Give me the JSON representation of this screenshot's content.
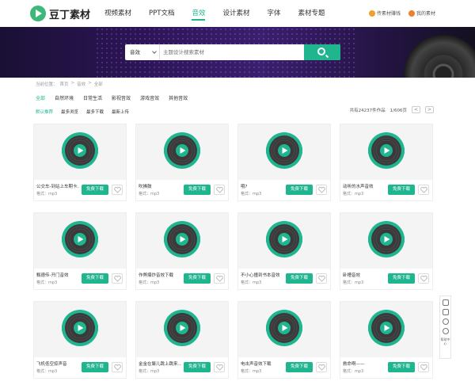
{
  "logo": {
    "text": "豆丁素材"
  },
  "nav": [
    {
      "label": "视频素材",
      "active": false
    },
    {
      "label": "PPT文档",
      "active": false
    },
    {
      "label": "音效",
      "active": true
    },
    {
      "label": "设计素材",
      "active": false
    },
    {
      "label": "字体",
      "active": false
    },
    {
      "label": "素材专题",
      "active": false
    }
  ],
  "top_right": {
    "upload_label": "传素材赚钱",
    "my_label": "我的素材"
  },
  "search": {
    "type_label": "音效",
    "placeholder": "主题设计搜索素材"
  },
  "breadcrumb": [
    "当前位置：",
    "首页",
    ">",
    "音效",
    ">",
    "全部"
  ],
  "categories": [
    {
      "label": "全部",
      "active": true
    },
    {
      "label": "自然环境",
      "active": false
    },
    {
      "label": "日常生活",
      "active": false
    },
    {
      "label": "影视音效",
      "active": false
    },
    {
      "label": "游戏音效",
      "active": false
    },
    {
      "label": "其他音效",
      "active": false
    }
  ],
  "sorts": [
    {
      "label": "默认推荐",
      "active": true
    },
    {
      "label": "最多浏览",
      "active": false
    },
    {
      "label": "最多下载",
      "active": false
    },
    {
      "label": "最新上传",
      "active": false
    }
  ],
  "summary": {
    "total": "共有24237件作品",
    "page": "1/606页",
    "prev": "<",
    "next": ">"
  },
  "card_common": {
    "format": "格式：mp3",
    "download_label": "免费下载"
  },
  "cards": [
    {
      "title": "公交车-到站上车期卡..."
    },
    {
      "title": "吹拂鼓"
    },
    {
      "title": "哦?"
    },
    {
      "title": "动听的水声音效"
    },
    {
      "title": "甄德传-开门音效"
    },
    {
      "title": "作弊爆炸音效下载"
    },
    {
      "title": "不小心撞到书本音效"
    },
    {
      "title": "卧槽音效"
    },
    {
      "title": "飞机低空掠声音"
    },
    {
      "title": "金金在聚儿跳上跳来..."
    },
    {
      "title": "电击声音效下载"
    },
    {
      "title": "救命啊——"
    }
  ],
  "side_tools": {
    "help_label": "帮助中心"
  },
  "colors": {
    "accent": "#1fb58f",
    "banner": "#2c1556"
  }
}
